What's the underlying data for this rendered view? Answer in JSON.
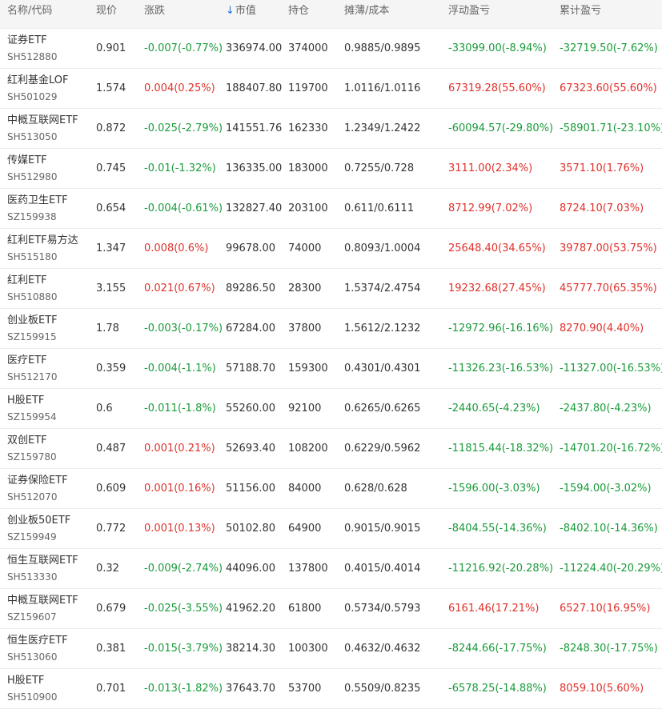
{
  "colors": {
    "up": "#e0302a",
    "down": "#1a9b3b",
    "accent": "#1e6fd9"
  },
  "header": {
    "name_code": "名称/代码",
    "price": "现价",
    "change": "涨跌",
    "sort_icon": "sort-down-arrow-icon",
    "sort_arrow": "↓",
    "market_value": "市值",
    "holdings": "持仓",
    "cost": "摊薄/成本",
    "floating_pl": "浮动盈亏",
    "cumulative_pl": "累计盈亏"
  },
  "rows": [
    {
      "name": "证券ETF",
      "code": "SH512880",
      "price": "0.901",
      "change": "-0.007(-0.77%)",
      "market_value": "336974.00",
      "holdings": "374000",
      "cost": "0.9885/0.9895",
      "floating_pl": "-33099.00(-8.94%)",
      "cumulative_pl": "-32719.50(-7.62%)"
    },
    {
      "name": "红利基金LOF",
      "code": "SH501029",
      "price": "1.574",
      "change": "0.004(0.25%)",
      "market_value": "188407.80",
      "holdings": "119700",
      "cost": "1.0116/1.0116",
      "floating_pl": "67319.28(55.60%)",
      "cumulative_pl": "67323.60(55.60%)"
    },
    {
      "name": "中概互联网ETF",
      "code": "SH513050",
      "price": "0.872",
      "change": "-0.025(-2.79%)",
      "market_value": "141551.76",
      "holdings": "162330",
      "cost": "1.2349/1.2422",
      "floating_pl": "-60094.57(-29.80%)",
      "cumulative_pl": "-58901.71(-23.10%)"
    },
    {
      "name": "传媒ETF",
      "code": "SH512980",
      "price": "0.745",
      "change": "-0.01(-1.32%)",
      "market_value": "136335.00",
      "holdings": "183000",
      "cost": "0.7255/0.728",
      "floating_pl": "3111.00(2.34%)",
      "cumulative_pl": "3571.10(1.76%)"
    },
    {
      "name": "医药卫生ETF",
      "code": "SZ159938",
      "price": "0.654",
      "change": "-0.004(-0.61%)",
      "market_value": "132827.40",
      "holdings": "203100",
      "cost": "0.611/0.6111",
      "floating_pl": "8712.99(7.02%)",
      "cumulative_pl": "8724.10(7.03%)"
    },
    {
      "name": "红利ETF易方达",
      "code": "SH515180",
      "price": "1.347",
      "change": "0.008(0.6%)",
      "market_value": "99678.00",
      "holdings": "74000",
      "cost": "0.8093/1.0004",
      "floating_pl": "25648.40(34.65%)",
      "cumulative_pl": "39787.00(53.75%)"
    },
    {
      "name": "红利ETF",
      "code": "SH510880",
      "price": "3.155",
      "change": "0.021(0.67%)",
      "market_value": "89286.50",
      "holdings": "28300",
      "cost": "1.5374/2.4754",
      "floating_pl": "19232.68(27.45%)",
      "cumulative_pl": "45777.70(65.35%)"
    },
    {
      "name": "创业板ETF",
      "code": "SZ159915",
      "price": "1.78",
      "change": "-0.003(-0.17%)",
      "market_value": "67284.00",
      "holdings": "37800",
      "cost": "1.5612/2.1232",
      "floating_pl": "-12972.96(-16.16%)",
      "cumulative_pl": "8270.90(4.40%)"
    },
    {
      "name": "医疗ETF",
      "code": "SH512170",
      "price": "0.359",
      "change": "-0.004(-1.1%)",
      "market_value": "57188.70",
      "holdings": "159300",
      "cost": "0.4301/0.4301",
      "floating_pl": "-11326.23(-16.53%)",
      "cumulative_pl": "-11327.00(-16.53%)"
    },
    {
      "name": "H股ETF",
      "code": "SZ159954",
      "price": "0.6",
      "change": "-0.011(-1.8%)",
      "market_value": "55260.00",
      "holdings": "92100",
      "cost": "0.6265/0.6265",
      "floating_pl": "-2440.65(-4.23%)",
      "cumulative_pl": "-2437.80(-4.23%)"
    },
    {
      "name": "双创ETF",
      "code": "SZ159780",
      "price": "0.487",
      "change": "0.001(0.21%)",
      "market_value": "52693.40",
      "holdings": "108200",
      "cost": "0.6229/0.5962",
      "floating_pl": "-11815.44(-18.32%)",
      "cumulative_pl": "-14701.20(-16.72%)"
    },
    {
      "name": "证券保险ETF",
      "code": "SH512070",
      "price": "0.609",
      "change": "0.001(0.16%)",
      "market_value": "51156.00",
      "holdings": "84000",
      "cost": "0.628/0.628",
      "floating_pl": "-1596.00(-3.03%)",
      "cumulative_pl": "-1594.00(-3.02%)"
    },
    {
      "name": "创业板50ETF",
      "code": "SZ159949",
      "price": "0.772",
      "change": "0.001(0.13%)",
      "market_value": "50102.80",
      "holdings": "64900",
      "cost": "0.9015/0.9015",
      "floating_pl": "-8404.55(-14.36%)",
      "cumulative_pl": "-8402.10(-14.36%)"
    },
    {
      "name": "恒生互联网ETF",
      "code": "SH513330",
      "price": "0.32",
      "change": "-0.009(-2.74%)",
      "market_value": "44096.00",
      "holdings": "137800",
      "cost": "0.4015/0.4014",
      "floating_pl": "-11216.92(-20.28%)",
      "cumulative_pl": "-11224.40(-20.29%)"
    },
    {
      "name": "中概互联网ETF",
      "code": "SZ159607",
      "price": "0.679",
      "change": "-0.025(-3.55%)",
      "market_value": "41962.20",
      "holdings": "61800",
      "cost": "0.5734/0.5793",
      "floating_pl": "6161.46(17.21%)",
      "cumulative_pl": "6527.10(16.95%)"
    },
    {
      "name": "恒生医疗ETF",
      "code": "SH513060",
      "price": "0.381",
      "change": "-0.015(-3.79%)",
      "market_value": "38214.30",
      "holdings": "100300",
      "cost": "0.4632/0.4632",
      "floating_pl": "-8244.66(-17.75%)",
      "cumulative_pl": "-8248.30(-17.75%)"
    },
    {
      "name": "H股ETF",
      "code": "SH510900",
      "price": "0.701",
      "change": "-0.013(-1.82%)",
      "market_value": "37643.70",
      "holdings": "53700",
      "cost": "0.5509/0.8235",
      "floating_pl": "-6578.25(-14.88%)",
      "cumulative_pl": "8059.10(5.60%)"
    }
  ]
}
